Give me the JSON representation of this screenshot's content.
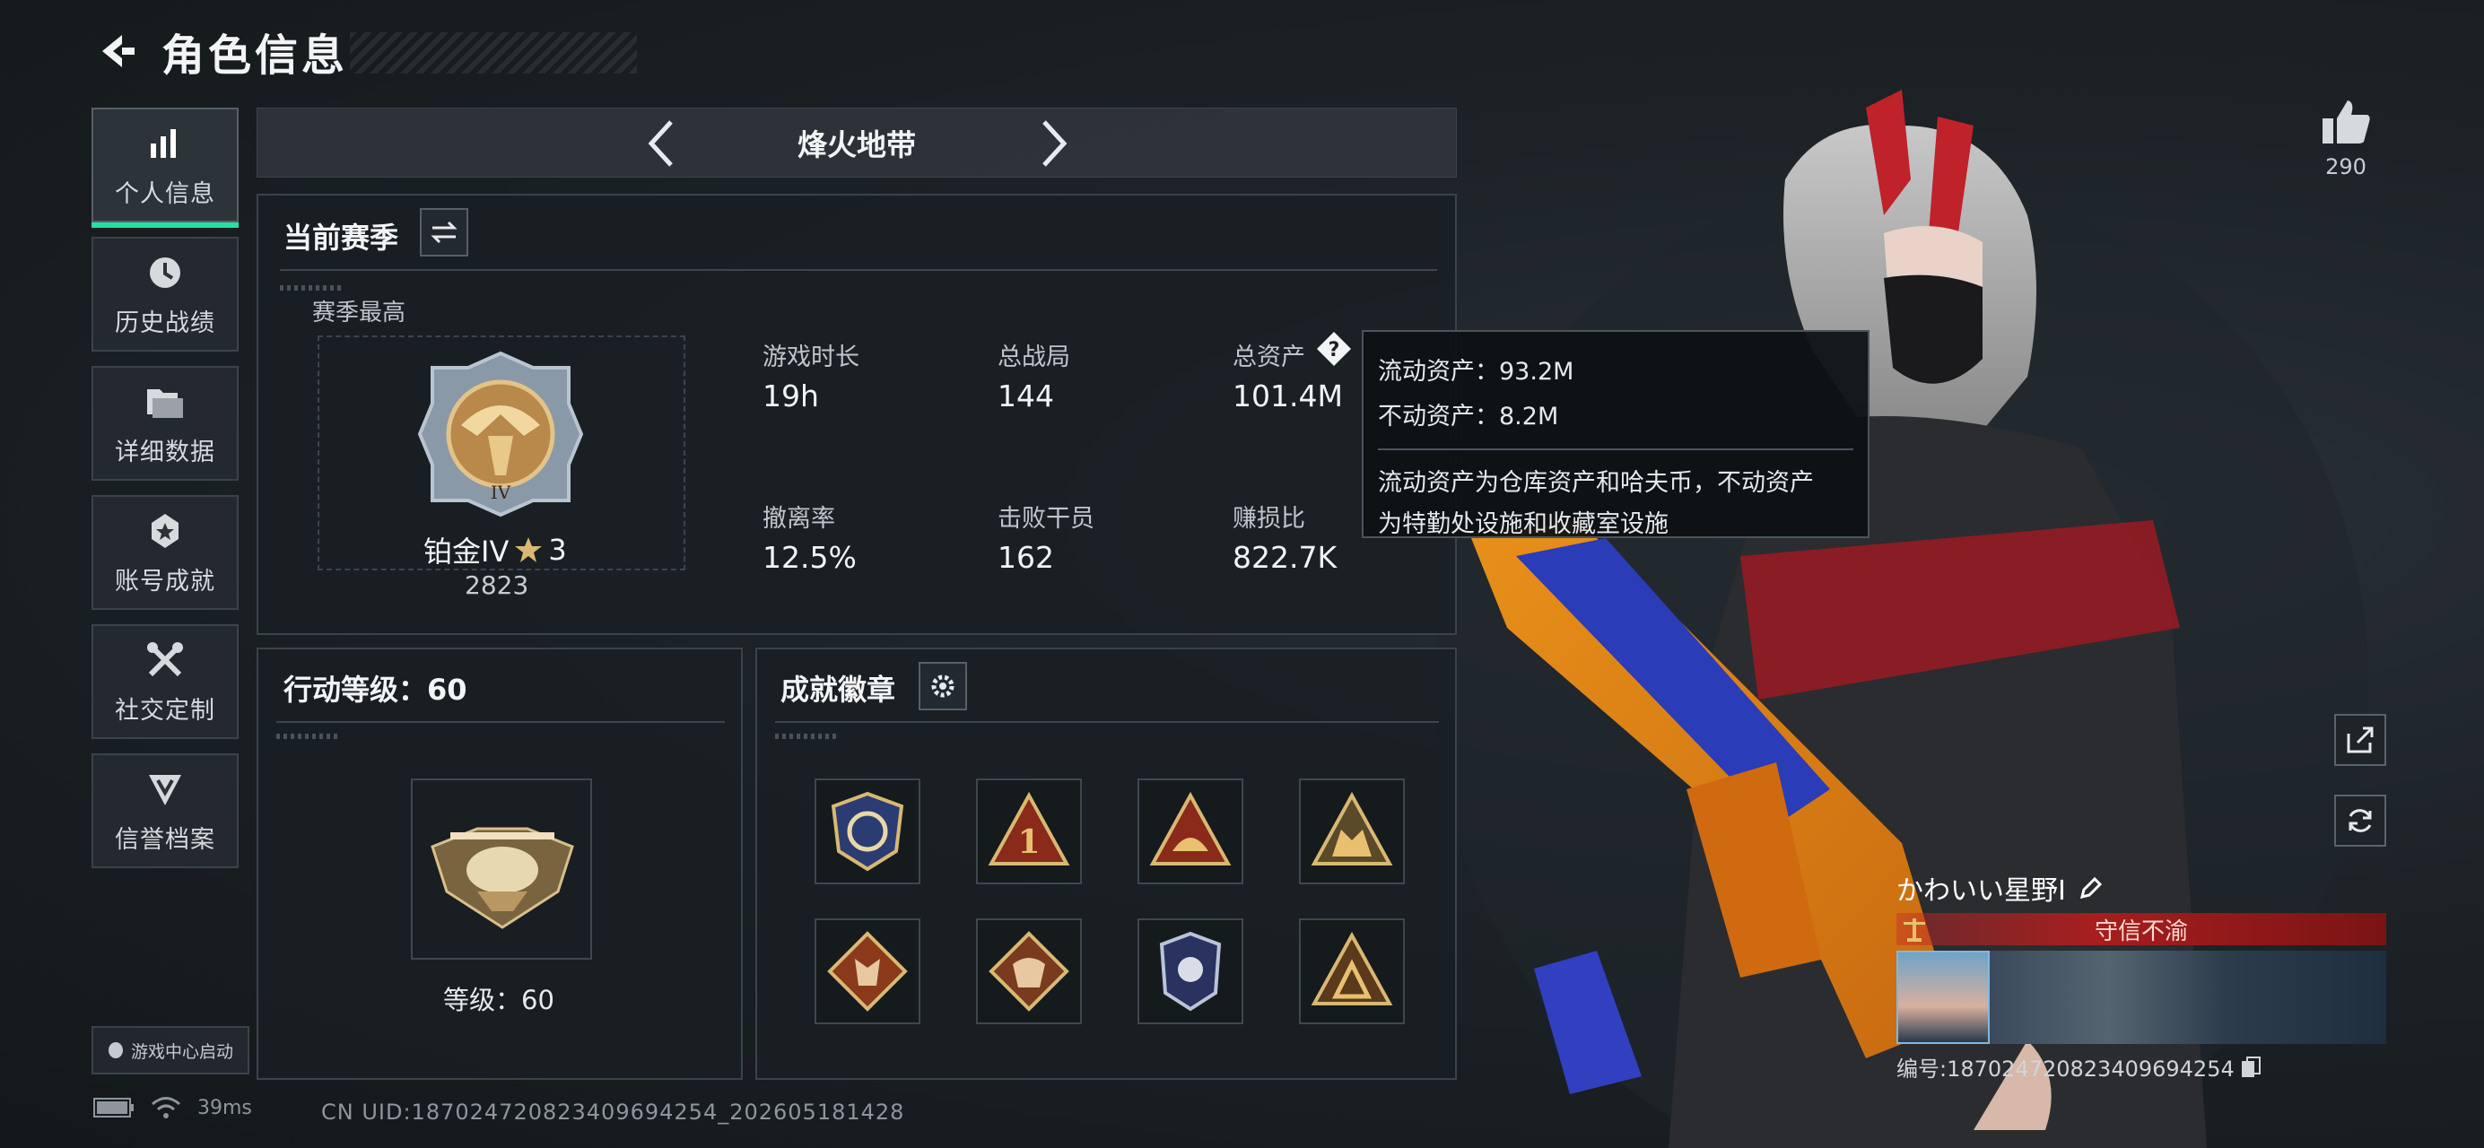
{
  "header": {
    "title": "角色信息"
  },
  "nav": {
    "items": [
      {
        "label": "个人信息",
        "icon": "bar-chart-icon",
        "active": true
      },
      {
        "label": "历史战绩",
        "icon": "history-clock-icon"
      },
      {
        "label": "详细数据",
        "icon": "folder-icon"
      },
      {
        "label": "账号成就",
        "icon": "achievement-icon"
      },
      {
        "label": "社交定制",
        "icon": "tools-icon"
      },
      {
        "label": "信誉档案",
        "icon": "reputation-shield-icon"
      }
    ],
    "game_center": "游戏中心启动"
  },
  "mode": {
    "title": "烽火地带"
  },
  "season": {
    "title": "当前赛季",
    "best_label": "赛季最高",
    "rank_name": "铂金IV",
    "rank_stars": "3",
    "rank_score": "2823",
    "stats": [
      {
        "label": "游戏时长",
        "value": "19h"
      },
      {
        "label": "总战局",
        "value": "144"
      },
      {
        "label": "总资产",
        "value": "101.4M"
      },
      {
        "label": "撤离率",
        "value": "12.5%"
      },
      {
        "label": "击败干员",
        "value": "162"
      },
      {
        "label": "赚损比",
        "value": "822.7K"
      }
    ]
  },
  "tooltip": {
    "liquid": "流动资产：93.2M",
    "fixed": "不动资产：8.2M",
    "note_line1": "流动资产为仓库资产和哈夫币，不动资产",
    "note_line2": "为特勤处设施和收藏室设施"
  },
  "level": {
    "title": "行动等级：60",
    "label": "等级：60"
  },
  "badges": {
    "title": "成就徽章",
    "items": [
      "shield-badge-icon",
      "rank-1-badge-icon",
      "helmet-badge-icon",
      "squad-badge-icon",
      "wolf-badge-icon",
      "dragon-badge-icon",
      "police-badge-icon",
      "star-badge-icon"
    ]
  },
  "player": {
    "name": "かわいい星野I",
    "title": "守信不渝",
    "id": "编号:1870247208234096942​54"
  },
  "likes": "290",
  "status": {
    "ping": "39ms"
  },
  "uid": "CN UID:187024720823409694254_202605181428",
  "colors": {
    "accent": "#27e0a0",
    "title_red": "#a71e1e",
    "panel_border": "#3b434a"
  }
}
